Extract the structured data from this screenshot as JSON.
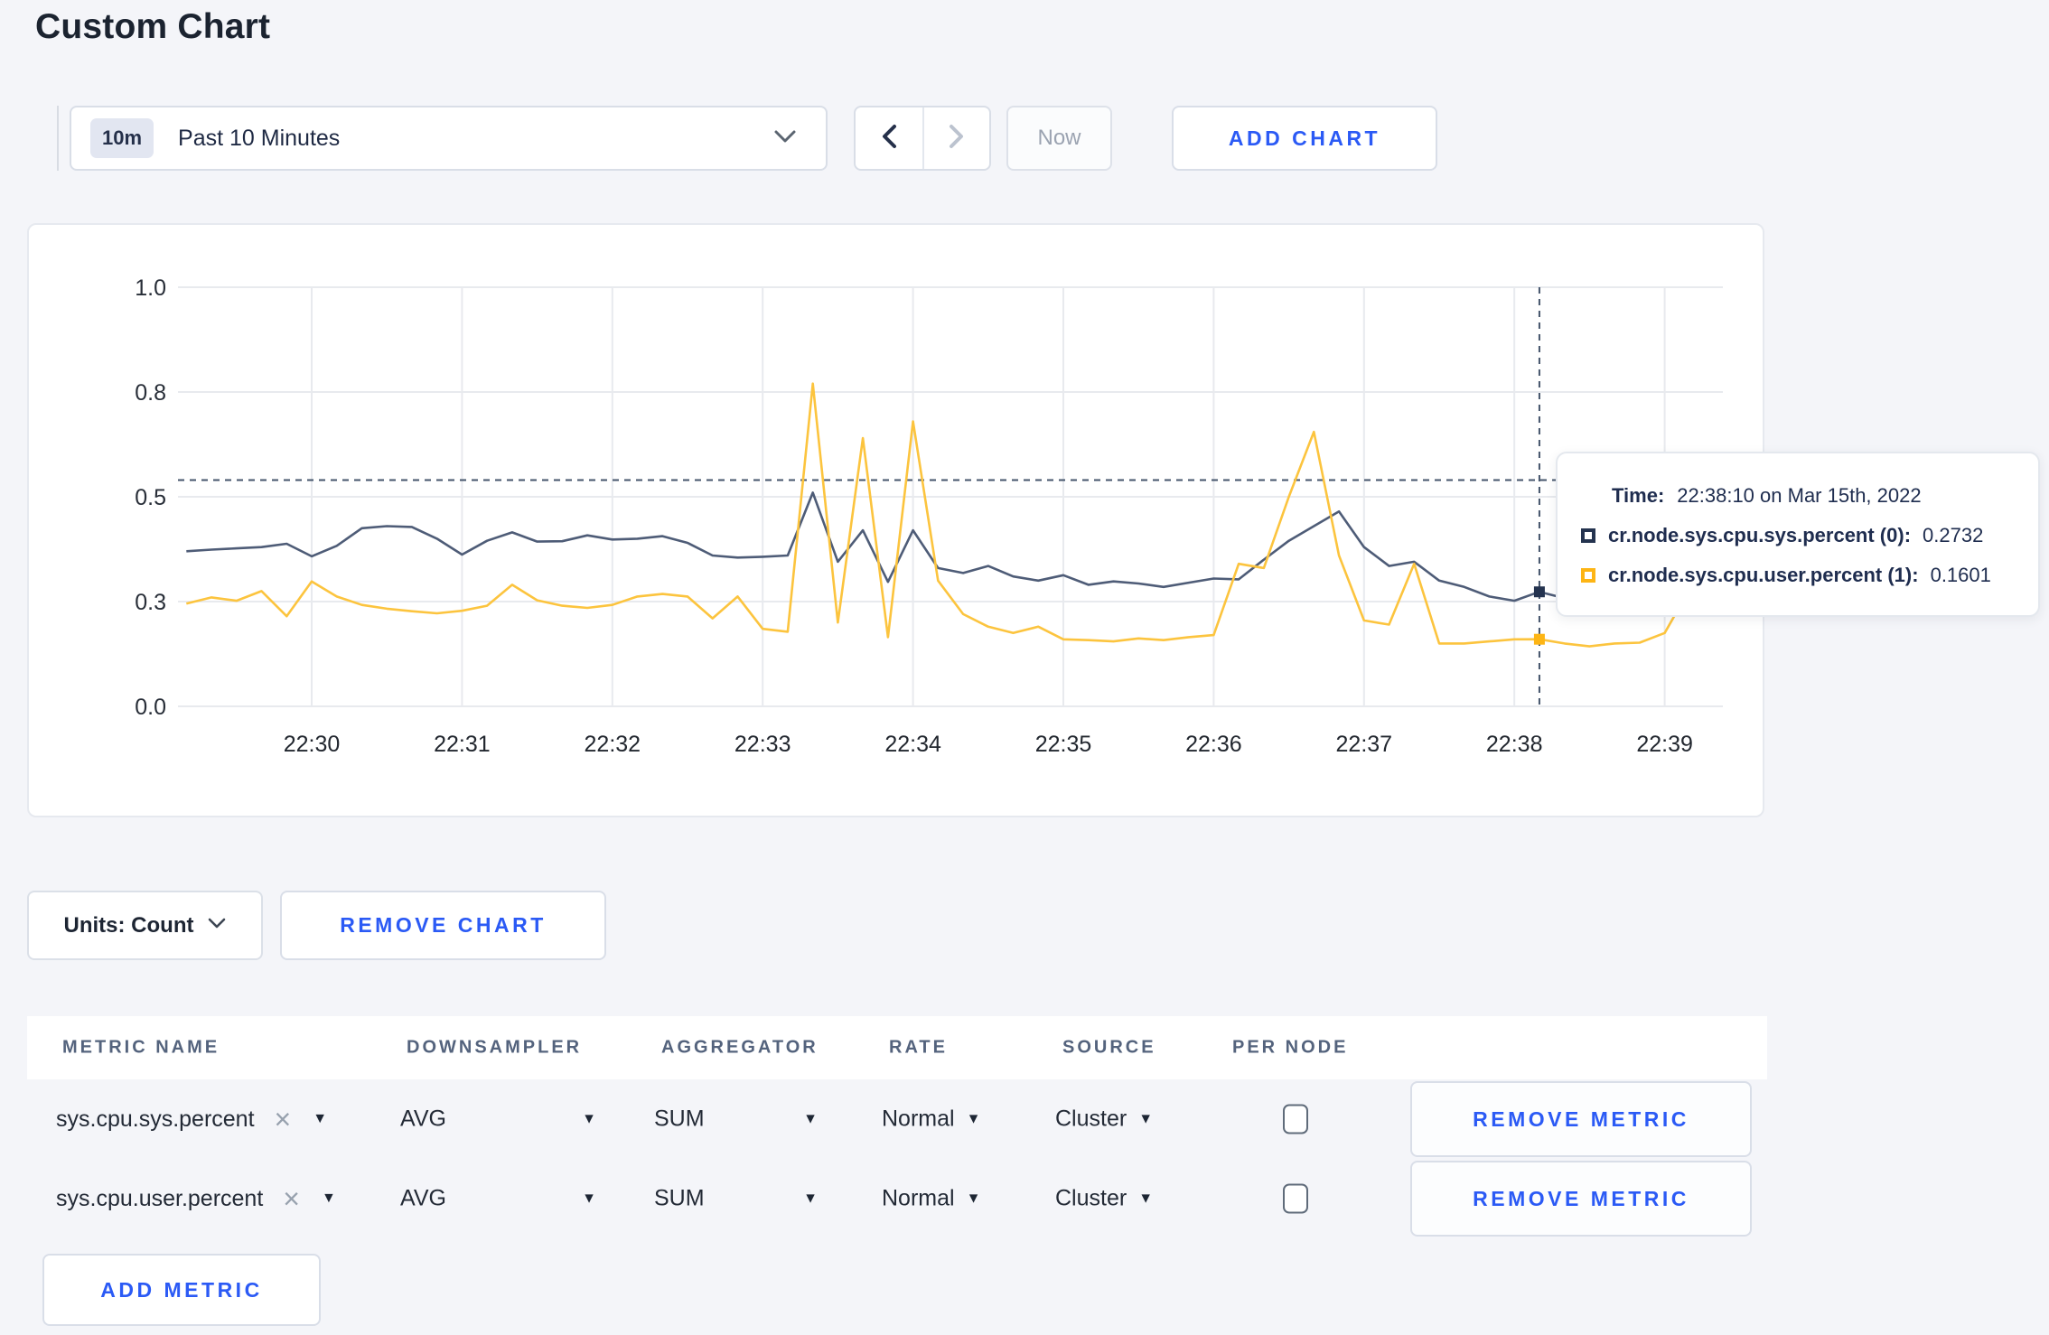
{
  "page": {
    "title": "Custom Chart"
  },
  "toolbar": {
    "range_badge": "10m",
    "range_label": "Past 10 Minutes",
    "dropdown_icon": "chevron-down-icon",
    "prev_icon": "chevron-left-icon",
    "next_icon": "chevron-right-icon",
    "now_label": "Now",
    "add_chart_label": "ADD CHART"
  },
  "chart_card": {
    "tooltip": {
      "time_label": "Time:",
      "time_value": "22:38:10 on Mar 15th, 2022",
      "series": [
        {
          "name": "cr.node.sys.cpu.sys.percent (0):",
          "value": "0.2732",
          "swatch_color": "#24334f"
        },
        {
          "name": "cr.node.sys.cpu.user.percent (1):",
          "value": "0.1601",
          "swatch_color": "#fdb515"
        }
      ]
    }
  },
  "chart_data": {
    "type": "line",
    "title": "",
    "xlabel": "",
    "ylabel": "",
    "grid": true,
    "legend_position": "none",
    "ylim": [
      0,
      1
    ],
    "y_tick_values": [
      0,
      0.25,
      0.5,
      0.75,
      1.0
    ],
    "y_tick_labels": [
      "0.0",
      "0.3",
      "0.5",
      "0.8",
      "1.0"
    ],
    "x_start": "22:29:10",
    "x_step_seconds": 10,
    "x_tick_labels": [
      "22:30",
      "22:31",
      "22:32",
      "22:33",
      "22:34",
      "22:35",
      "22:36",
      "22:37",
      "22:38",
      "22:39"
    ],
    "crosshair": {
      "time_index": 54,
      "time_label": "22:38:10",
      "hline_value": 0.54
    },
    "series": [
      {
        "name": "cr.node.sys.cpu.sys.percent",
        "color": "#4e5c77",
        "dot_color": "#24334f",
        "highlight_value": 0.2732,
        "values": [
          0.37,
          0.374,
          0.377,
          0.38,
          0.388,
          0.358,
          0.383,
          0.425,
          0.43,
          0.428,
          0.4,
          0.362,
          0.395,
          0.415,
          0.393,
          0.394,
          0.408,
          0.398,
          0.4,
          0.406,
          0.39,
          0.36,
          0.355,
          0.357,
          0.36,
          0.51,
          0.345,
          0.42,
          0.297,
          0.42,
          0.33,
          0.318,
          0.335,
          0.31,
          0.3,
          0.313,
          0.29,
          0.298,
          0.293,
          0.285,
          0.295,
          0.305,
          0.303,
          0.35,
          0.395,
          0.43,
          0.465,
          0.38,
          0.335,
          0.345,
          0.3,
          0.285,
          0.262,
          0.252,
          0.2732,
          0.258,
          0.285,
          0.292,
          0.27,
          0.258,
          0.268
        ]
      },
      {
        "name": "cr.node.sys.cpu.user.percent",
        "color": "#fcc43e",
        "dot_color": "#fdb515",
        "highlight_value": 0.1601,
        "values": [
          0.245,
          0.26,
          0.252,
          0.275,
          0.215,
          0.298,
          0.262,
          0.242,
          0.233,
          0.227,
          0.222,
          0.228,
          0.24,
          0.29,
          0.253,
          0.24,
          0.235,
          0.242,
          0.262,
          0.268,
          0.262,
          0.21,
          0.262,
          0.185,
          0.178,
          0.77,
          0.2,
          0.64,
          0.165,
          0.68,
          0.3,
          0.22,
          0.19,
          0.175,
          0.19,
          0.16,
          0.158,
          0.155,
          0.162,
          0.158,
          0.165,
          0.17,
          0.34,
          0.33,
          0.5,
          0.655,
          0.36,
          0.205,
          0.195,
          0.34,
          0.15,
          0.15,
          0.155,
          0.16,
          0.1601,
          0.15,
          0.143,
          0.15,
          0.152,
          0.175,
          0.28
        ]
      }
    ]
  },
  "units": {
    "label": "Units: Count",
    "remove_chart_label": "REMOVE CHART"
  },
  "metrics_table": {
    "headers": [
      "METRIC NAME",
      "DOWNSAMPLER",
      "AGGREGATOR",
      "RATE",
      "SOURCE",
      "PER NODE"
    ],
    "remove_metric_label": "REMOVE METRIC",
    "add_metric_label": "ADD METRIC",
    "rows": [
      {
        "name": "sys.cpu.sys.percent",
        "downsampler": "AVG",
        "aggregator": "SUM",
        "rate": "Normal",
        "source": "Cluster",
        "per_node_checked": false
      },
      {
        "name": "sys.cpu.user.percent",
        "downsampler": "AVG",
        "aggregator": "SUM",
        "rate": "Normal",
        "source": "Cluster",
        "per_node_checked": false
      }
    ]
  }
}
